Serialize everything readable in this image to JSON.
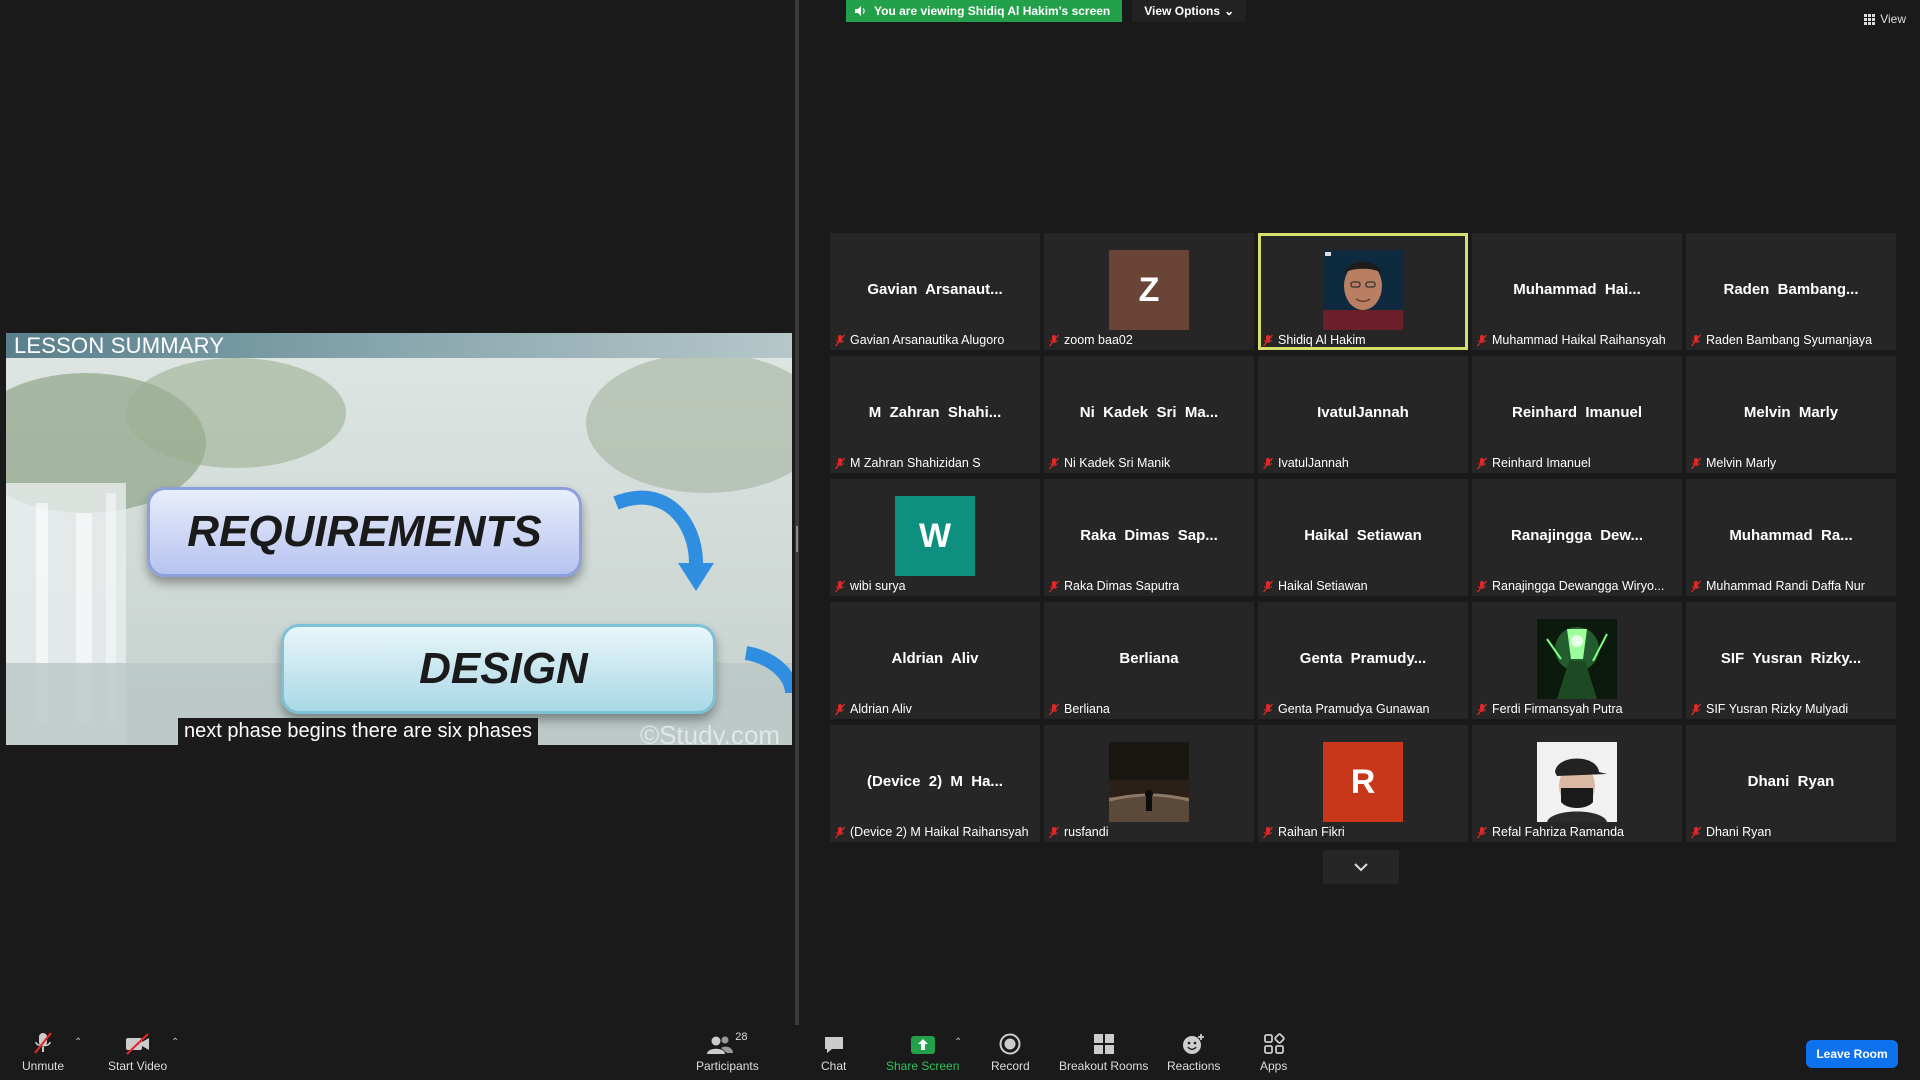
{
  "banner": {
    "viewing_text": "You are viewing Shidiq Al Hakim's screen",
    "view_options_label": "View Options",
    "view_label": "View"
  },
  "shared_screen": {
    "slide_title": "LESSON SUMMARY",
    "box1": "REQUIREMENTS",
    "box2": "DESIGN",
    "caption": "next phase begins there are six phases",
    "watermark": "©Study.com"
  },
  "participants": [
    {
      "center_name": "Gavian  Arsanaut...",
      "full_name": "Gavian Arsanautika Alugoro",
      "type": "name"
    },
    {
      "center_name": "",
      "full_name": "zoom baa02",
      "type": "letter",
      "letter": "Z",
      "color": "#6b4438"
    },
    {
      "center_name": "",
      "full_name": "Shidiq Al Hakim",
      "type": "photo",
      "photo": "face-man",
      "active": true
    },
    {
      "center_name": "Muhammad  Hai...",
      "full_name": "Muhammad Haikal Raihansyah",
      "type": "name"
    },
    {
      "center_name": "Raden  Bambang...",
      "full_name": "Raden Bambang Syumanjaya",
      "type": "name"
    },
    {
      "center_name": "M  Zahran  Shahi...",
      "full_name": "M Zahran Shahizidan S",
      "type": "name"
    },
    {
      "center_name": "Ni  Kadek  Sri  Ma...",
      "full_name": "Ni Kadek Sri Manik",
      "type": "name"
    },
    {
      "center_name": "IvatulJannah",
      "full_name": "IvatulJannah",
      "type": "name"
    },
    {
      "center_name": "Reinhard  Imanuel",
      "full_name": "Reinhard Imanuel",
      "type": "name"
    },
    {
      "center_name": "Melvin  Marly",
      "full_name": "Melvin Marly",
      "type": "name"
    },
    {
      "center_name": "",
      "full_name": "wibi surya",
      "type": "letter",
      "letter": "W",
      "color": "#0f8f80"
    },
    {
      "center_name": "Raka  Dimas  Sap...",
      "full_name": "Raka Dimas Saputra",
      "type": "name"
    },
    {
      "center_name": "Haikal  Setiawan",
      "full_name": "Haikal Setiawan",
      "type": "name"
    },
    {
      "center_name": "Ranajingga  Dew...",
      "full_name": "Ranajingga Dewangga Wiryo...",
      "type": "name"
    },
    {
      "center_name": "Muhammad  Ra...",
      "full_name": "Muhammad Randi Daffa Nur",
      "type": "name"
    },
    {
      "center_name": "Aldrian  Aliv",
      "full_name": "Aldrian Aliv",
      "type": "name"
    },
    {
      "center_name": "Berliana",
      "full_name": "Berliana",
      "type": "name"
    },
    {
      "center_name": "Genta  Pramudy...",
      "full_name": "Genta Pramudya Gunawan",
      "type": "name"
    },
    {
      "center_name": "",
      "full_name": "Ferdi Firmansyah Putra",
      "type": "photo",
      "photo": "green-art"
    },
    {
      "center_name": "SIF  Yusran  Rizky...",
      "full_name": "SIF Yusran Rizky Mulyadi",
      "type": "name"
    },
    {
      "center_name": "(Device  2)  M  Ha...",
      "full_name": "(Device 2) M Haikal Raihansyah",
      "type": "name"
    },
    {
      "center_name": "",
      "full_name": "rusfandi",
      "type": "photo",
      "photo": "dark-night"
    },
    {
      "center_name": "",
      "full_name": "Raihan Fikri",
      "type": "letter",
      "letter": "R",
      "color": "#c8371a"
    },
    {
      "center_name": "",
      "full_name": "Refal Fahriza Ramanda",
      "type": "photo",
      "photo": "masked-cap"
    },
    {
      "center_name": "Dhani  Ryan",
      "full_name": "Dhani Ryan",
      "type": "name"
    }
  ],
  "toolbar": {
    "unmute": "Unmute",
    "start_video": "Start Video",
    "participants": "Participants",
    "participants_count": "28",
    "chat": "Chat",
    "share_screen": "Share Screen",
    "record": "Record",
    "breakout_rooms": "Breakout Rooms",
    "reactions": "Reactions",
    "apps": "Apps",
    "leave_room": "Leave Room"
  },
  "colors": {
    "accent_green": "#23a04a",
    "active_speaker": "#d4e06a",
    "leave_blue": "#0e72ed",
    "mic_off_red": "#e02828"
  }
}
